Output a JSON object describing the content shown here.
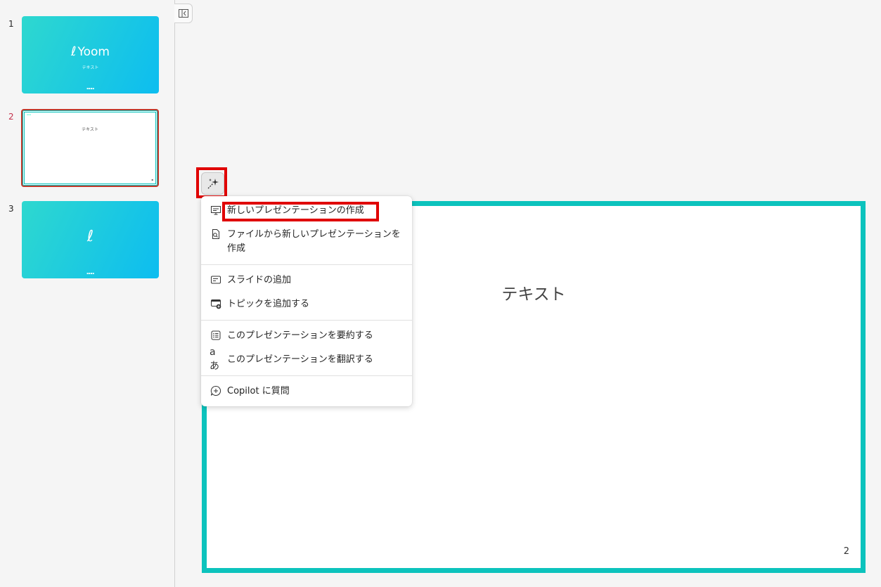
{
  "thumbnails": [
    {
      "number": "1",
      "brand": "Yoom",
      "subtitle": "テキスト"
    },
    {
      "number": "2",
      "text": "テキスト"
    },
    {
      "number": "3"
    }
  ],
  "slide": {
    "title": "テキスト",
    "page_number": "2"
  },
  "copilot_menu": {
    "items": [
      {
        "label": "新しいプレゼンテーションの作成",
        "icon": "presentation-icon"
      },
      {
        "label": "ファイルから新しいプレゼンテーションを作成",
        "icon": "file-search-icon"
      },
      {
        "label": "スライドの追加",
        "icon": "slide-add-icon"
      },
      {
        "label": "トピックを追加する",
        "icon": "topic-add-icon"
      },
      {
        "label": "このプレゼンテーションを要約する",
        "icon": "summarize-icon"
      },
      {
        "label": "このプレゼンテーションを翻訳する",
        "icon": "translate-icon"
      },
      {
        "label": "Copilot に質問",
        "icon": "chat-add-icon"
      }
    ]
  },
  "colors": {
    "accent": "#0cc3bd",
    "highlight": "#e00000",
    "selected": "#c0392b"
  }
}
